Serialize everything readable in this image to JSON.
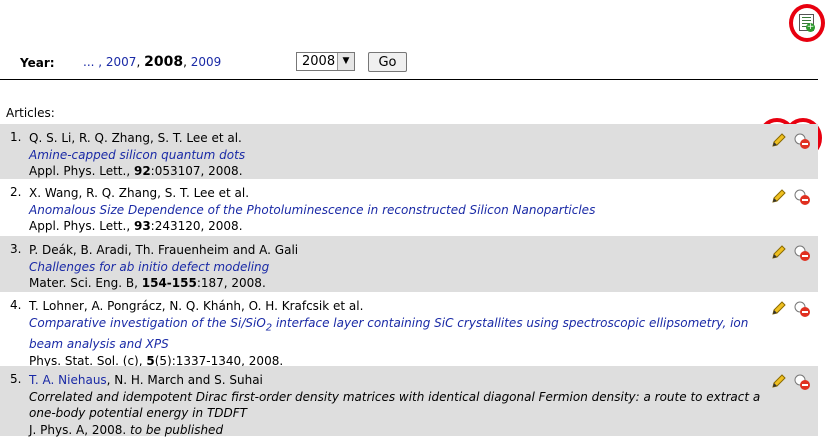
{
  "header": {
    "add_icon": "add-document-icon"
  },
  "year_nav": {
    "label": "Year:",
    "prefix": "... ,",
    "links": [
      "2007",
      "2008",
      "2009"
    ],
    "current": "2008",
    "select_value": "2008",
    "go_label": "Go"
  },
  "articles_label": "Articles:",
  "articles": [
    {
      "num": "1.",
      "authors": "Q. S. Li, R. Q. Zhang, S. T. Lee et al.",
      "title": "Amine-capped silicon quantum dots",
      "journal": "Appl. Phys. Lett.,",
      "volume": "92",
      "pages": ":053107, 2008."
    },
    {
      "num": "2.",
      "authors": "X. Wang, R. Q. Zhang, S. T. Lee et al.",
      "title": "Anomalous Size Dependence of the Photoluminescence in reconstructed Silicon Nanoparticles",
      "journal": "Appl. Phys. Lett.,",
      "volume": "93",
      "pages": ":243120, 2008."
    },
    {
      "num": "3.",
      "authors": "P. Deák, B. Aradi, Th. Frauenheim and A. Gali",
      "title": "Challenges for ab initio defect modeling",
      "journal": "Mater. Sci. Eng. B,",
      "volume": "154-155",
      "pages": ":187, 2008."
    },
    {
      "num": "4.",
      "authors": "T. Lohner, A. Pongrácz, N. Q. Khánh, O. H. Krafcsik et al.",
      "title_a": "Comparative investigation of the Si/SiO",
      "title_sub": "2",
      "title_b": " interface layer containing SiC crystallites using spectroscopic ellipsometry, ion beam analysis and XPS",
      "journal": "Phys. Stat. Sol. (c),",
      "volume": "5",
      "pages": "(5):1337-1340, 2008."
    },
    {
      "num": "5.",
      "author_link": "T. A. Niehaus",
      "authors_rest": ", N. H. March and S. Suhai",
      "title": "Correlated and idempotent Dirac first-order density matrices with identical diagonal Fermion density: a route to extract a one-body potential energy in TDDFT",
      "journal": "J. Phys. A, 2008.",
      "note": "to be published"
    }
  ],
  "colors": {
    "link": "#1a2aa6",
    "row_alt": "#dedede",
    "highlight_ring": "#e8000f"
  },
  "icons": {
    "edit": "pencil-icon",
    "delete": "delete-icon"
  }
}
